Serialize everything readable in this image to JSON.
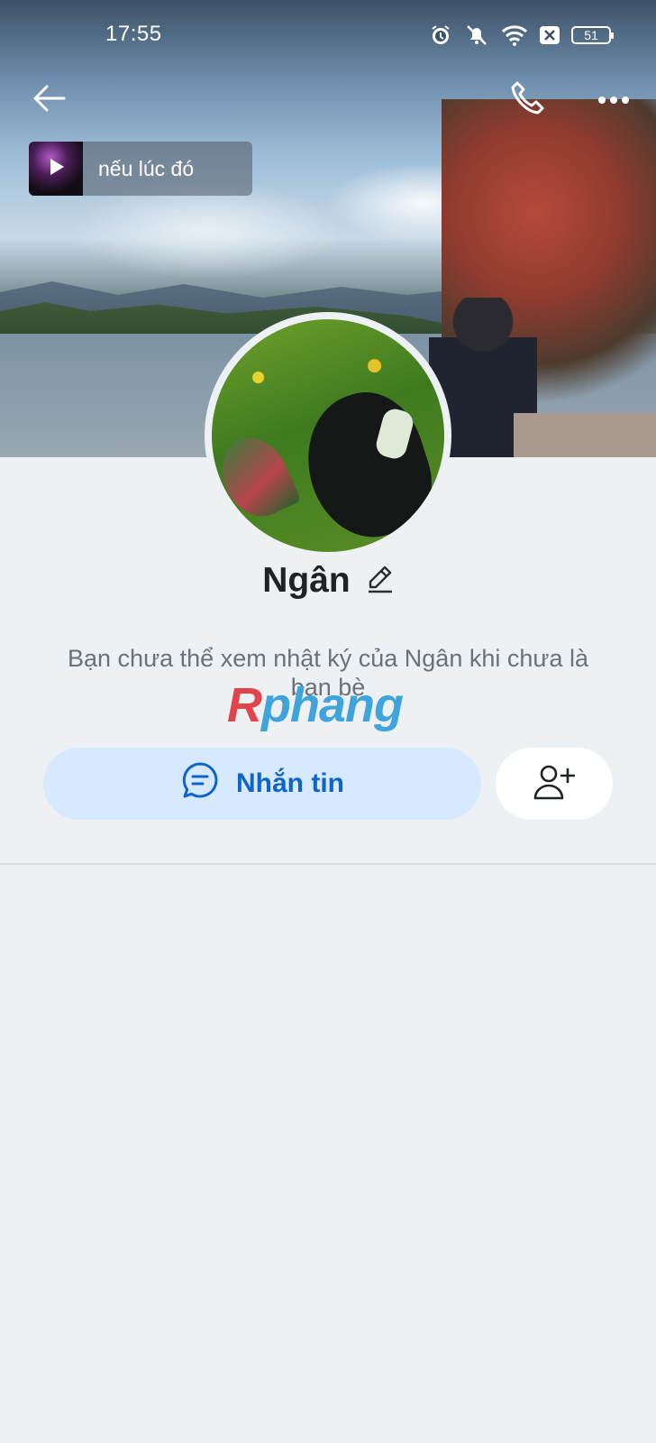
{
  "status_bar": {
    "time": "17:55",
    "battery": "51"
  },
  "profile": {
    "name": "Ngân",
    "music_title": "nếu lúc đó",
    "info_text": "Bạn chưa thể xem nhật ký của Ngân khi chưa là bạn bè"
  },
  "watermark": {
    "first": "R",
    "rest": "phang"
  },
  "actions": {
    "message_label": "Nhắn tin"
  },
  "colors": {
    "accent": "#0f64c9",
    "message_bg": "#d6e9ff",
    "page_bg": "#eef1f3"
  },
  "icons": [
    "alarm-icon",
    "mute-icon",
    "wifi-icon",
    "close-box-icon",
    "battery-icon",
    "back-arrow-icon",
    "phone-icon",
    "more-icon",
    "play-icon",
    "edit-pencil-icon",
    "chat-bubble-icon",
    "add-friend-icon"
  ]
}
